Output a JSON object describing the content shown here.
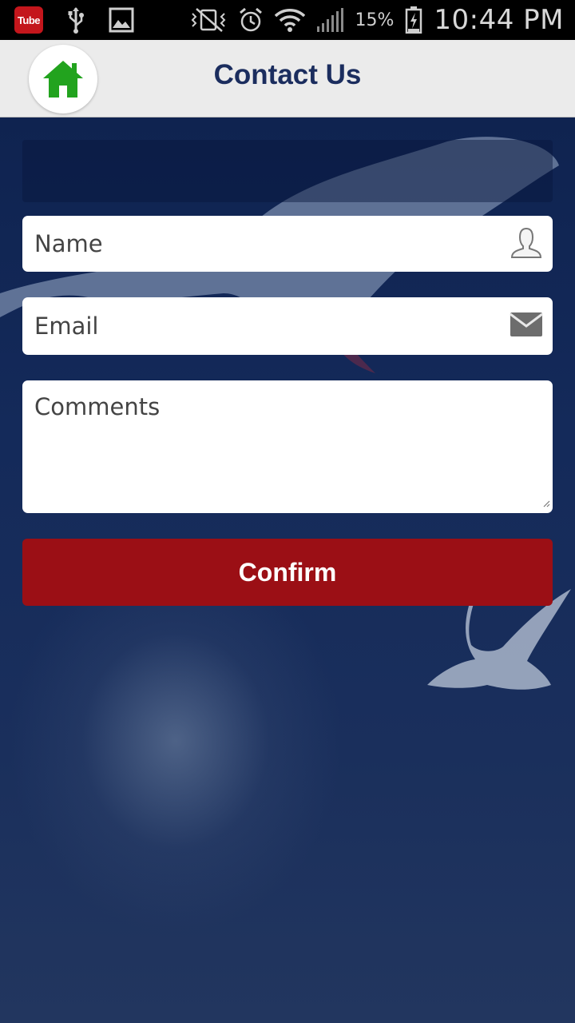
{
  "status_bar": {
    "youtube_label": "Tube",
    "battery_percent": "15%",
    "time": "10:44 PM",
    "icons": [
      "youtube-icon",
      "usb-icon",
      "gallery-icon",
      "mute-vibrate-icon",
      "alarm-icon",
      "wifi-icon",
      "signal-icon",
      "battery-charging-icon"
    ]
  },
  "header": {
    "title": "Contact Us",
    "home_icon_color": "#22a31e"
  },
  "form": {
    "name_placeholder": "Name",
    "email_placeholder": "Email",
    "comments_placeholder": "Comments",
    "name_value": "",
    "email_value": "",
    "comments_value": "",
    "confirm_label": "Confirm"
  },
  "colors": {
    "header_bg": "#ebebeb",
    "title_color": "#1b2d5e",
    "confirm_bg": "#9b0f15",
    "content_bg": "#1b2b55"
  }
}
